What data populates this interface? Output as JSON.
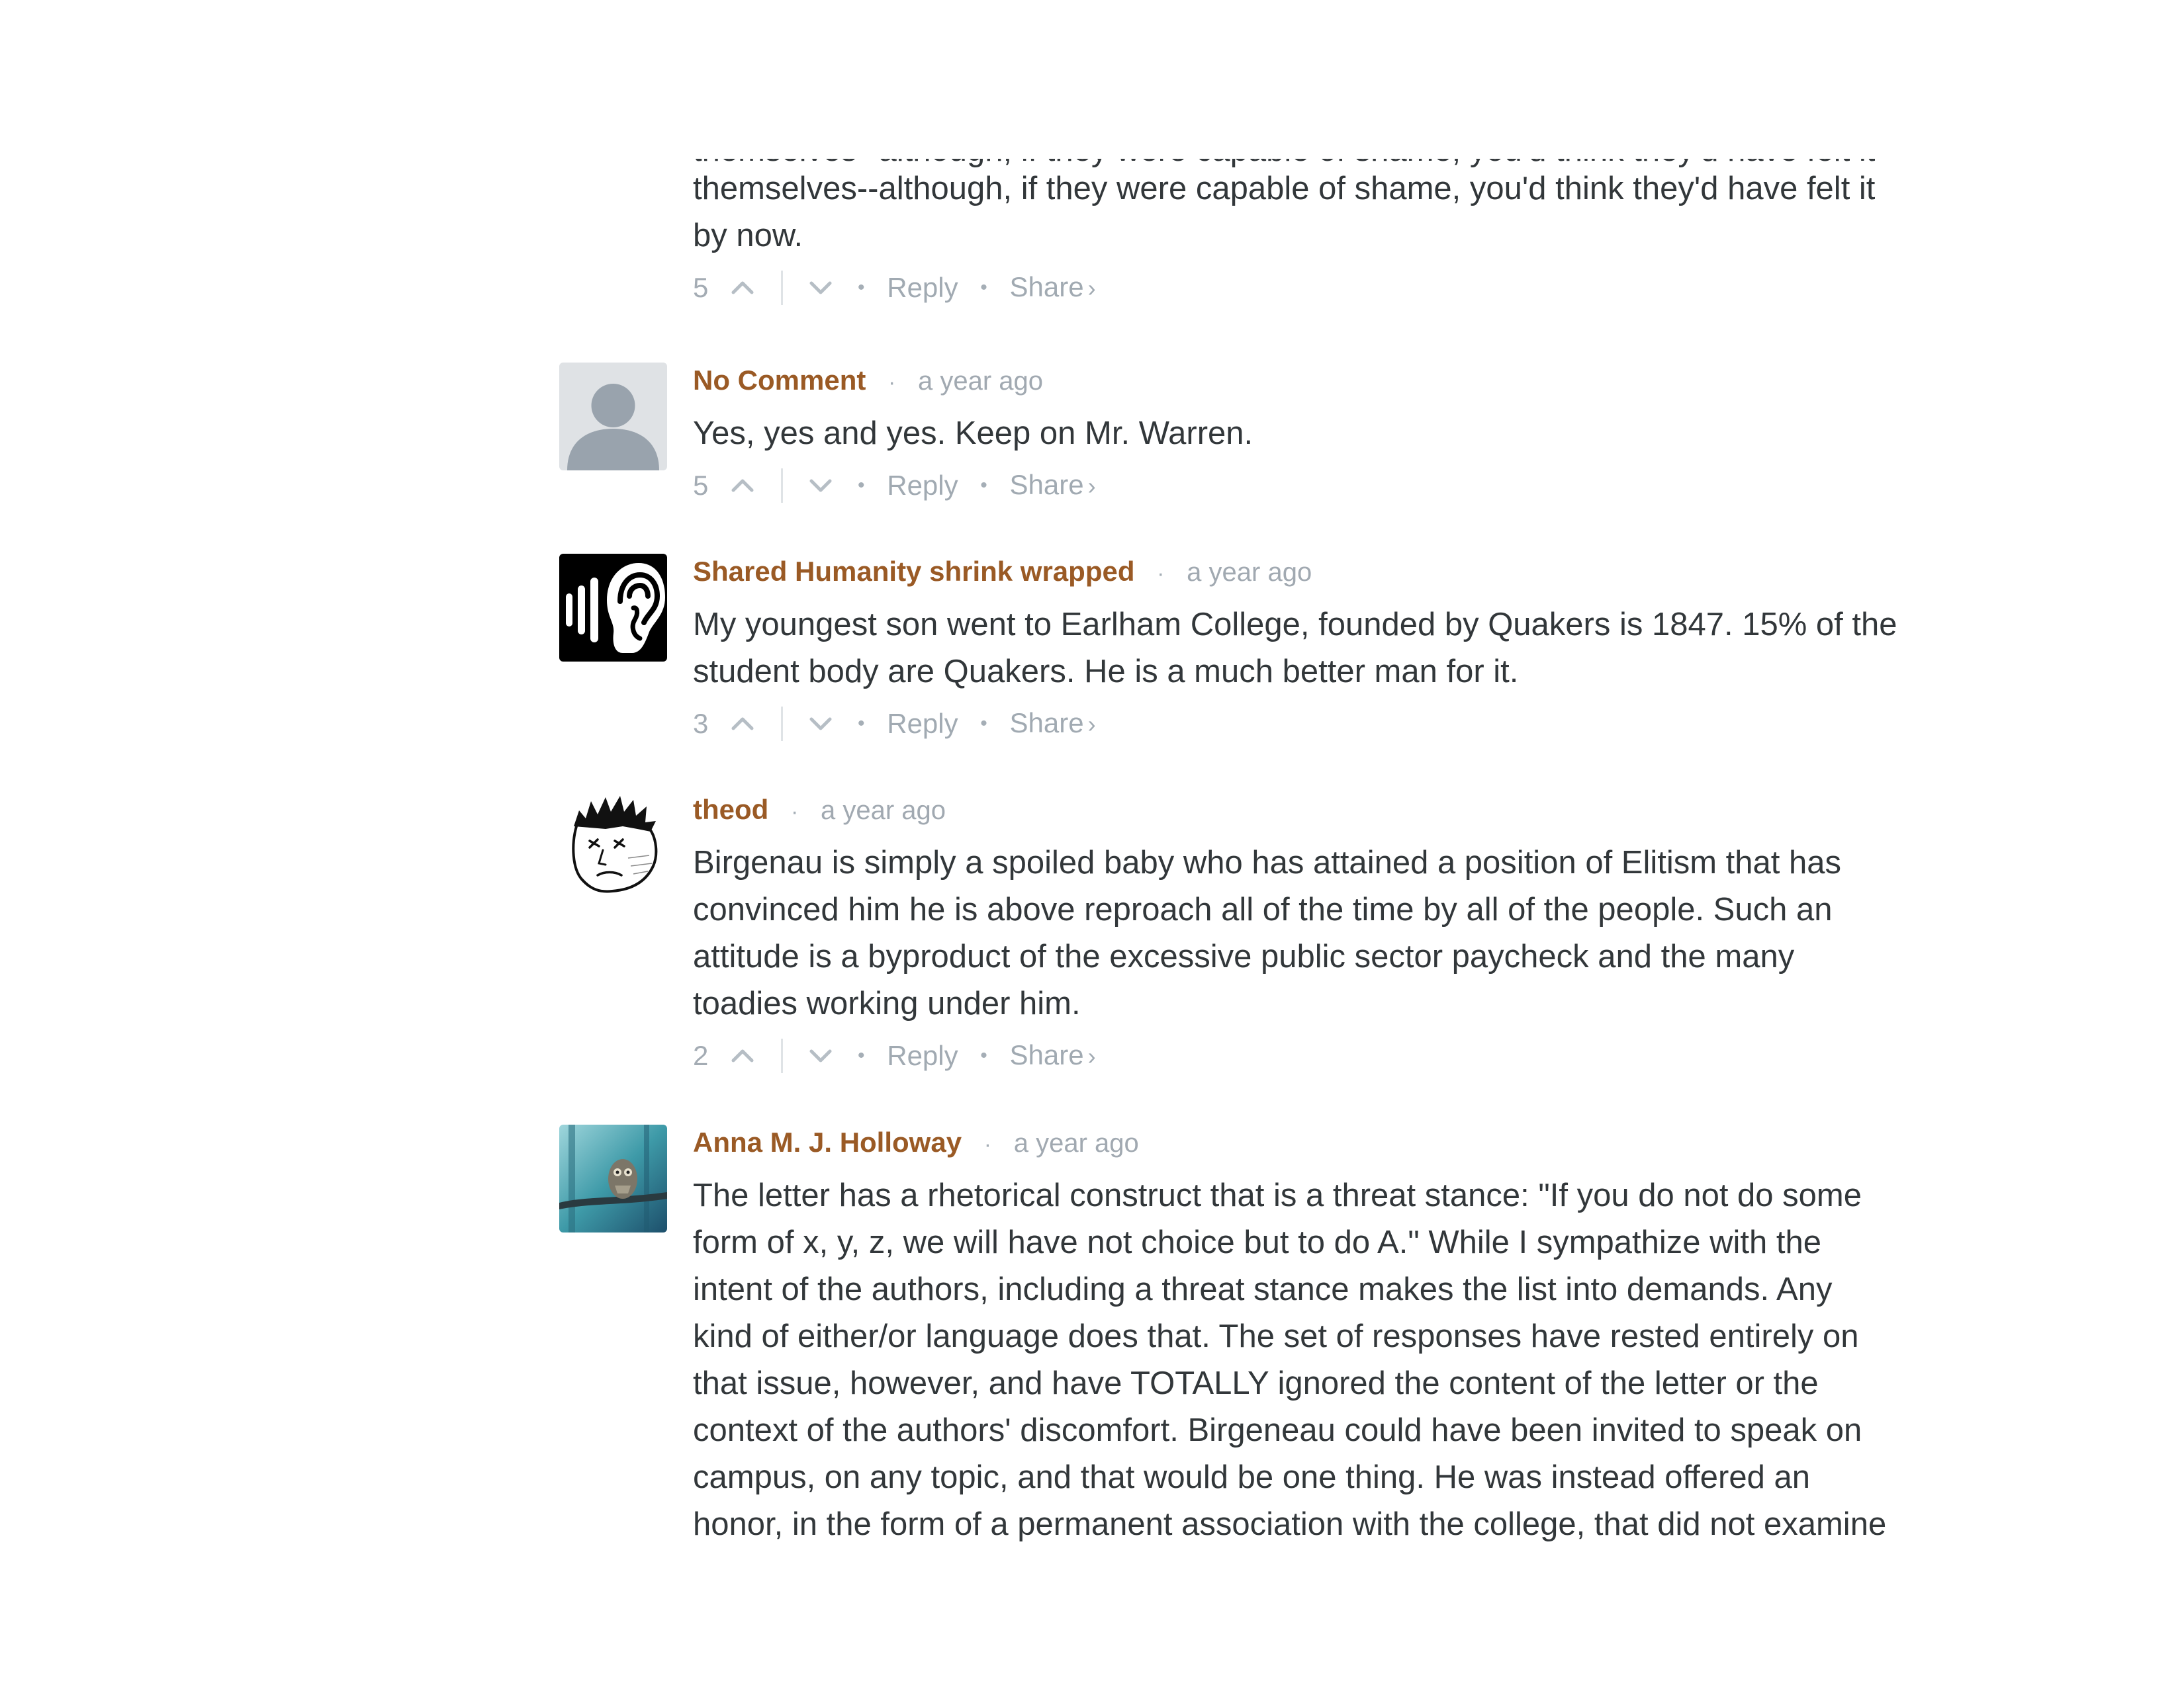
{
  "comments": [
    {
      "author": "",
      "time": "",
      "lines": [
        "themselves--although, if they were capable of shame, you'd think they'd have felt it",
        "by now."
      ],
      "upvotes": "5",
      "reply": "Reply",
      "share": "Share",
      "share_chevron": "›",
      "avatar": "none"
    },
    {
      "author": "No Comment",
      "time": "a year ago",
      "lines": [
        "Yes, yes and yes. Keep on Mr. Warren."
      ],
      "upvotes": "5",
      "reply": "Reply",
      "share": "Share",
      "share_chevron": "›",
      "avatar": "default-user-icon"
    },
    {
      "author": "Shared Humanity shrink wrapped",
      "time": "a year ago",
      "lines": [
        "My youngest son went to Earlham College, founded by Quakers is 1847. 15% of the",
        "student body are Quakers. He is a much better man for it."
      ],
      "upvotes": "3",
      "reply": "Reply",
      "share": "Share",
      "share_chevron": "›",
      "avatar": "ear-sound-icon"
    },
    {
      "author": "theod",
      "time": "a year ago",
      "lines": [
        "Birgenau is simply a spoiled baby who has attained a position of Elitism that has",
        "convinced him he is above reproach all of the time by all of the people. Such an",
        "attitude is a byproduct of the excessive public sector paycheck and the many",
        "toadies working under him."
      ],
      "upvotes": "2",
      "reply": "Reply",
      "share": "Share",
      "share_chevron": "›",
      "avatar": "sketched-face-icon"
    },
    {
      "author": "Anna M. J. Holloway",
      "time": "a year ago",
      "lines": [
        "The letter has a rhetorical construct that is a threat stance: \"If you do not do some",
        "form of x, y, z, we will have not choice but to do A.\" While I sympathize with the",
        "intent of the authors, including a threat stance makes the list into demands. Any",
        "kind of either/or language does that. The set of responses have rested entirely on",
        "that issue, however, and have TOTALLY ignored the content of the letter or the",
        "context of the authors' discomfort. Birgeneau could have been invited to speak on",
        "campus, on any topic, and that would be one thing. He was instead offered an",
        "honor, in the form of a permanent association with the college, that did not examine"
      ],
      "upvotes": "",
      "reply": "",
      "share": "",
      "share_chevron": "",
      "avatar": "owl-photo-icon"
    }
  ],
  "separators": {
    "dot": "·",
    "action_dot": "•"
  },
  "icons": {
    "upvote": "chevron-up-icon",
    "downvote": "chevron-down-icon"
  },
  "colors": {
    "author": "#9a5a25",
    "meta": "#a1a9b1",
    "text": "#32373a"
  }
}
